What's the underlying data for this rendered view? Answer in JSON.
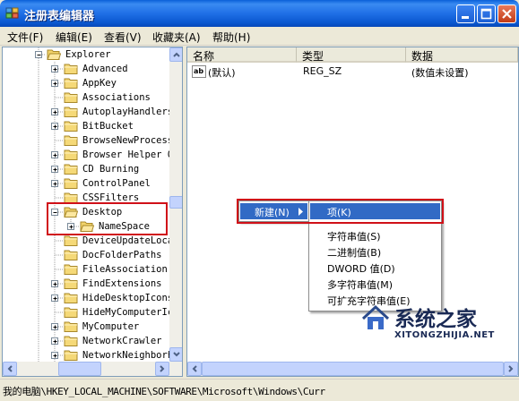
{
  "window": {
    "title": "注册表编辑器"
  },
  "menu": [
    "文件(F)",
    "编辑(E)",
    "查看(V)",
    "收藏夹(A)",
    "帮助(H)"
  ],
  "tree": {
    "root": "Explorer",
    "items": [
      {
        "label": "Advanced",
        "expander": "plus"
      },
      {
        "label": "AppKey",
        "expander": "plus"
      },
      {
        "label": "Associations",
        "expander": "none"
      },
      {
        "label": "AutoplayHandlers",
        "expander": "plus"
      },
      {
        "label": "BitBucket",
        "expander": "plus"
      },
      {
        "label": "BrowseNewProcess",
        "expander": "none"
      },
      {
        "label": "Browser Helper O",
        "expander": "plus"
      },
      {
        "label": "CD Burning",
        "expander": "plus"
      },
      {
        "label": "ControlPanel",
        "expander": "plus"
      },
      {
        "label": "CSSFilters",
        "expander": "none"
      },
      {
        "label": "Desktop",
        "expander": "minus"
      },
      {
        "label": "NameSpace",
        "expander": "plus",
        "child": true
      },
      {
        "label": "DeviceUpdateLoca",
        "expander": "none"
      },
      {
        "label": "DocFolderPaths",
        "expander": "none"
      },
      {
        "label": "FileAssociation",
        "expander": "none"
      },
      {
        "label": "FindExtensions",
        "expander": "plus"
      },
      {
        "label": "HideDesktopIcons",
        "expander": "plus"
      },
      {
        "label": "HideMyComputerIc",
        "expander": "none"
      },
      {
        "label": "MyComputer",
        "expander": "plus"
      },
      {
        "label": "NetworkCrawler",
        "expander": "plus"
      },
      {
        "label": "NetworkNeighborh",
        "expander": "plus"
      }
    ]
  },
  "list": {
    "columns": [
      "名称",
      "类型",
      "数据"
    ],
    "rows": [
      {
        "name": "(默认)",
        "type": "REG_SZ",
        "data": "(数值未设置)"
      }
    ]
  },
  "context_menu": {
    "new_label": "新建(N)",
    "submenu": [
      "项(K)",
      "字符串值(S)",
      "二进制值(B)",
      "DWORD 值(D)",
      "多字符串值(M)",
      "可扩充字符串值(E)"
    ]
  },
  "status": "我的电脑\\HKEY_LOCAL_MACHINE\\SOFTWARE\\Microsoft\\Windows\\Curr",
  "watermark": {
    "main": "系统之家",
    "sub": "XITONGZHIJIA.NET"
  },
  "colors": {
    "title_bar": "#0a5fd8",
    "highlight": "#316ac5",
    "annotation_red": "#d01018"
  }
}
